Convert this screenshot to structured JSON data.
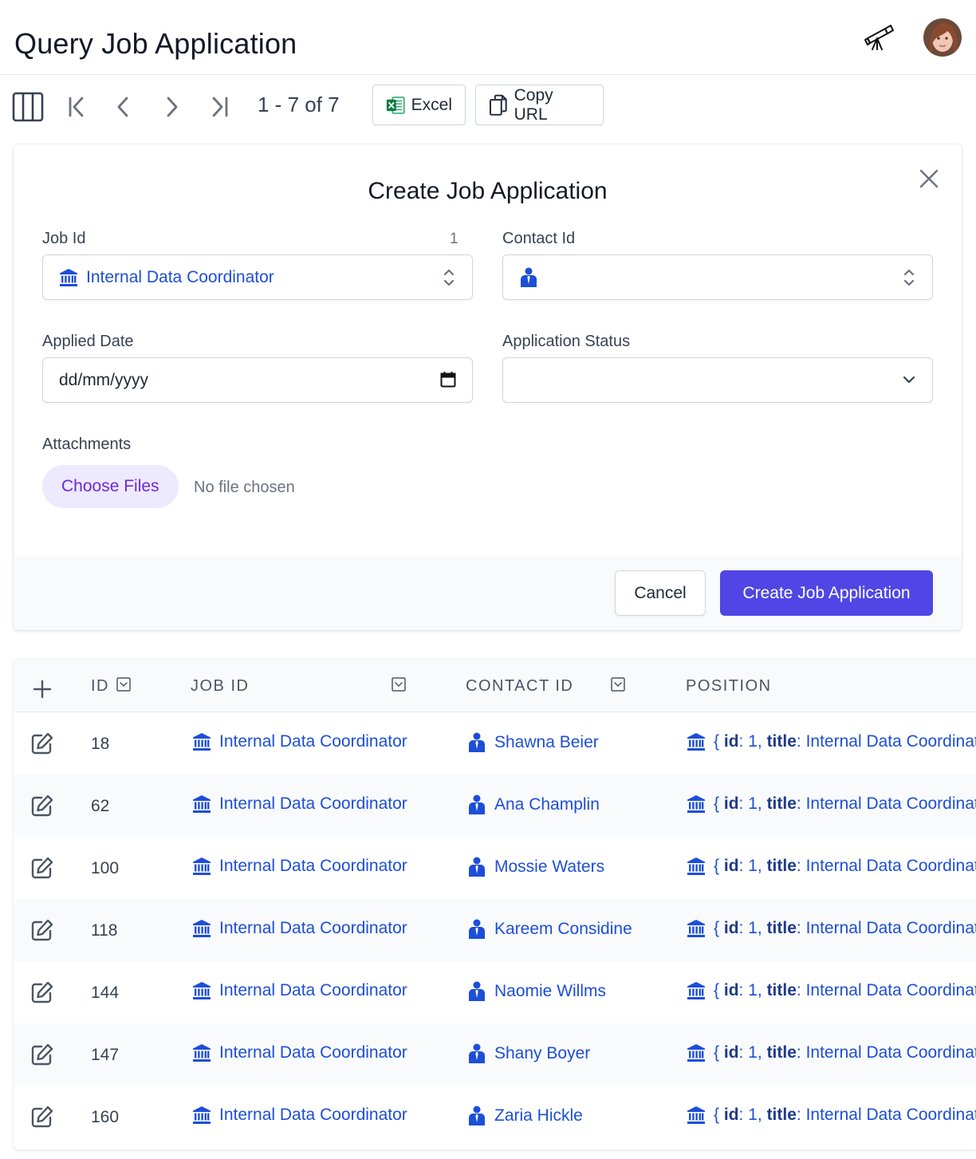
{
  "header": {
    "title": "Query Job Application"
  },
  "toolbar": {
    "paging": "1 - 7 of 7",
    "excel_label": "Excel",
    "copy_url_label": "Copy URL"
  },
  "form": {
    "title": "Create Job Application",
    "job_id": {
      "label": "Job Id",
      "hint": "1",
      "value": "Internal Data Coordinator"
    },
    "contact_id": {
      "label": "Contact Id",
      "value": ""
    },
    "applied_date": {
      "label": "Applied Date",
      "placeholder": "dd/mm/yyyy"
    },
    "application_status": {
      "label": "Application Status",
      "value": ""
    },
    "attachments": {
      "label": "Attachments",
      "button": "Choose Files",
      "status": "No file chosen"
    },
    "cancel_label": "Cancel",
    "submit_label": "Create Job Application"
  },
  "table": {
    "columns": [
      "ID",
      "JOB ID",
      "CONTACT ID",
      "POSITION"
    ],
    "rows": [
      {
        "id": "18",
        "job": "Internal Data Coordinator",
        "contact": "Shawna Beier",
        "position_id": "1",
        "position_title": "Internal Data Coordinat"
      },
      {
        "id": "62",
        "job": "Internal Data Coordinator",
        "contact": "Ana Champlin",
        "position_id": "1",
        "position_title": "Internal Data Coordinat"
      },
      {
        "id": "100",
        "job": "Internal Data Coordinator",
        "contact": "Mossie Waters",
        "position_id": "1",
        "position_title": "Internal Data Coordinat"
      },
      {
        "id": "118",
        "job": "Internal Data Coordinator",
        "contact": "Kareem Considine",
        "position_id": "1",
        "position_title": "Internal Data Coordinat"
      },
      {
        "id": "144",
        "job": "Internal Data Coordinator",
        "contact": "Naomie Willms",
        "position_id": "1",
        "position_title": "Internal Data Coordinat"
      },
      {
        "id": "147",
        "job": "Internal Data Coordinator",
        "contact": "Shany Boyer",
        "position_id": "1",
        "position_title": "Internal Data Coordinat"
      },
      {
        "id": "160",
        "job": "Internal Data Coordinator",
        "contact": "Zaria Hickle",
        "position_id": "1",
        "position_title": "Internal Data Coordinat"
      }
    ]
  },
  "colors": {
    "accent": "#4f46e5",
    "link": "#1d4ed8",
    "row_alt": "#f9fafb"
  },
  "icons": [
    "columns-icon",
    "first-page-icon",
    "prev-page-icon",
    "next-page-icon",
    "last-page-icon",
    "excel-icon",
    "copy-icon",
    "telescope-icon",
    "close-icon",
    "bank-icon",
    "person-icon",
    "calendar-icon",
    "edit-icon",
    "plus-icon",
    "filter-icon"
  ]
}
